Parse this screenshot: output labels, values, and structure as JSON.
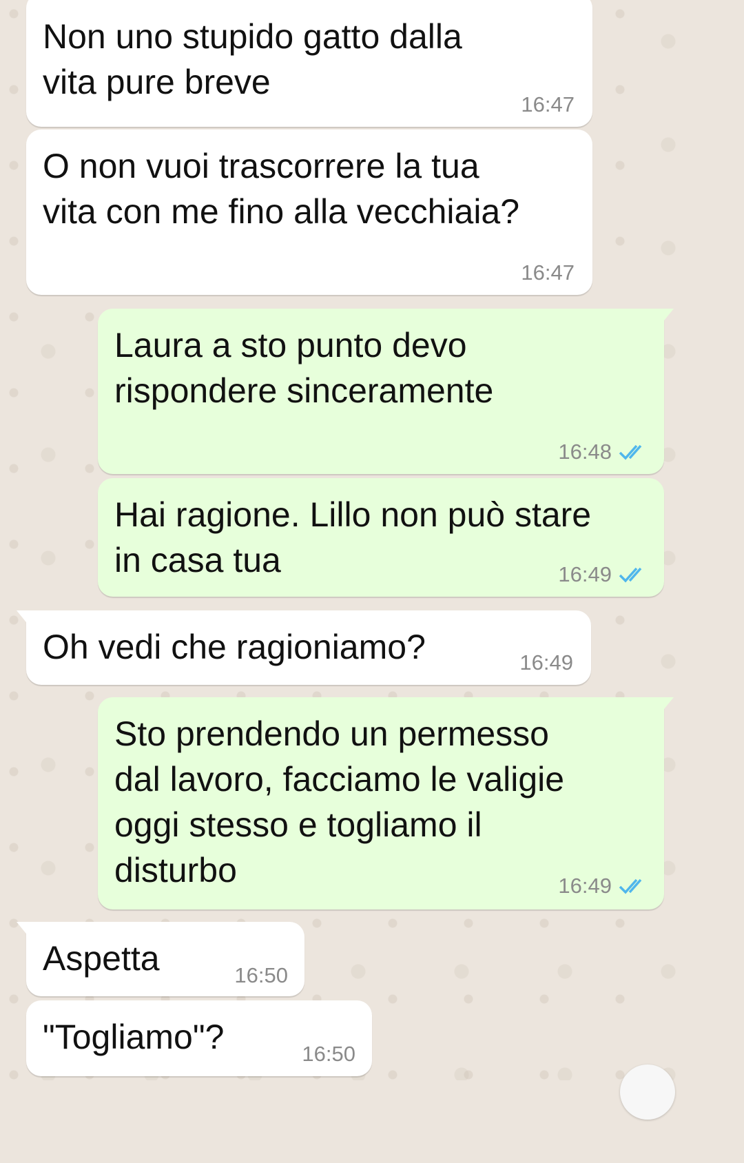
{
  "messages": [
    {
      "direction": "in",
      "text": "Non uno stupido gatto dalla\nvita pure breve",
      "time": "16:47"
    },
    {
      "direction": "in",
      "text": "O non vuoi trascorrere la tua\nvita con me fino alla vecchiaia?",
      "time": "16:47"
    },
    {
      "direction": "out",
      "text": "Laura a sto punto devo\nrispondere sinceramente",
      "time": "16:48",
      "status": "read"
    },
    {
      "direction": "out",
      "text": "Hai ragione. Lillo non può stare\nin casa tua",
      "time": "16:49",
      "status": "read"
    },
    {
      "direction": "in",
      "text": "Oh vedi che ragioniamo?",
      "time": "16:49"
    },
    {
      "direction": "out",
      "text": "Sto prendendo un permesso\ndal lavoro, facciamo le valigie\noggi stesso e togliamo il\ndisturbo",
      "time": "16:49",
      "status": "read"
    },
    {
      "direction": "in",
      "text": "Aspetta",
      "time": "16:50"
    },
    {
      "direction": "in",
      "text": "\"Togliamo\"?",
      "time": "16:50"
    }
  ],
  "colors": {
    "incoming_bubble": "#ffffff",
    "outgoing_bubble": "#e7ffdb",
    "read_tick": "#4fb6ec",
    "timestamp": "#8a8a8a"
  },
  "icons": {
    "read_status": "double-check-icon"
  }
}
